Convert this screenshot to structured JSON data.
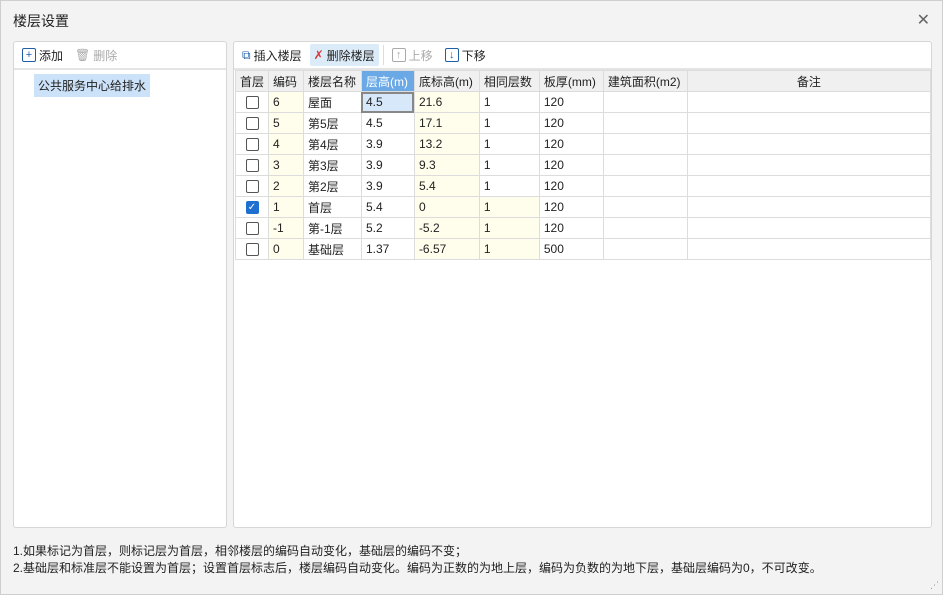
{
  "title": "楼层设置",
  "left": {
    "add": "添加",
    "delete": "删除",
    "items": [
      "公共服务中心给排水"
    ]
  },
  "toolbar": {
    "insert": "插入楼层",
    "remove": "删除楼层",
    "up": "上移",
    "down": "下移"
  },
  "columns": [
    "首层",
    "编码",
    "楼层名称",
    "层高(m)",
    "底标高(m)",
    "相同层数",
    "板厚(mm)",
    "建筑面积(m2)",
    "备注"
  ],
  "rows": [
    {
      "first": false,
      "code": "6",
      "name": "屋面",
      "height": "4.5",
      "elev": "21.6",
      "same": "1",
      "slab": "120",
      "area": "",
      "note": ""
    },
    {
      "first": false,
      "code": "5",
      "name": "第5层",
      "height": "4.5",
      "elev": "17.1",
      "same": "1",
      "slab": "120",
      "area": "",
      "note": ""
    },
    {
      "first": false,
      "code": "4",
      "name": "第4层",
      "height": "3.9",
      "elev": "13.2",
      "same": "1",
      "slab": "120",
      "area": "",
      "note": ""
    },
    {
      "first": false,
      "code": "3",
      "name": "第3层",
      "height": "3.9",
      "elev": "9.3",
      "same": "1",
      "slab": "120",
      "area": "",
      "note": ""
    },
    {
      "first": false,
      "code": "2",
      "name": "第2层",
      "height": "3.9",
      "elev": "5.4",
      "same": "1",
      "slab": "120",
      "area": "",
      "note": ""
    },
    {
      "first": true,
      "code": "1",
      "name": "首层",
      "height": "5.4",
      "elev": "0",
      "same": "1",
      "slab": "120",
      "area": "",
      "note": ""
    },
    {
      "first": false,
      "code": "-1",
      "name": "第-1层",
      "height": "5.2",
      "elev": "-5.2",
      "same": "1",
      "slab": "120",
      "area": "",
      "note": ""
    },
    {
      "first": false,
      "code": "0",
      "name": "基础层",
      "height": "1.37",
      "elev": "-6.57",
      "same": "1",
      "slab": "500",
      "area": "",
      "note": ""
    }
  ],
  "notes": [
    "1.如果标记为首层，则标记层为首层，相邻楼层的编码自动变化，基础层的编码不变；",
    "2.基础层和标准层不能设置为首层；设置首层标志后，楼层编码自动变化。编码为正数的为地上层，编码为负数的为地下层，基础层编码为0，不可改变。"
  ]
}
